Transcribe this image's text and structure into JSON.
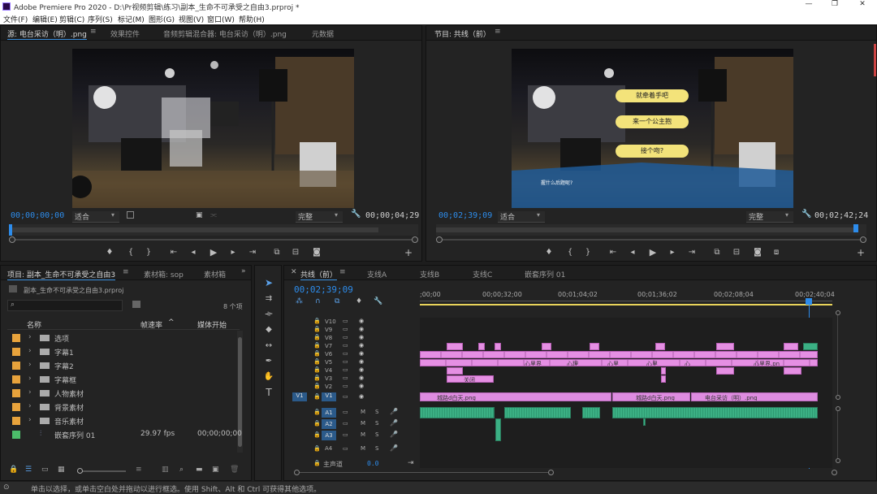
{
  "app": {
    "title": "Adobe Premiere Pro 2020 - D:\\Pr视频剪辑\\练习\\副本_生命不可承受之自由3.prproj *"
  },
  "menu": [
    "文件(F)",
    "编辑(E)",
    "剪辑(C)",
    "序列(S)",
    "标记(M)",
    "图形(G)",
    "视图(V)",
    "窗口(W)",
    "帮助(H)"
  ],
  "source": {
    "tabs": [
      "源: 电台采访（明）.png",
      "效果控件",
      "音频剪辑混合器: 电台采访（明）.png",
      "元数据"
    ],
    "timecode": "00;00;00;00",
    "fit": "适合",
    "quality": "完整",
    "duration": "00;00;04;29"
  },
  "program": {
    "tab": "节目: 共线（前）",
    "timecode": "00;02;39;09",
    "fit": "适合",
    "quality": "完整",
    "duration": "00;02;42;24",
    "bubbles": [
      "就牵着手吧",
      "来一个公主抱",
      "接个吻?"
    ],
    "caption": "握什么后题呢?"
  },
  "project": {
    "tabs": [
      "项目: 副本_生命不可承受之自由3",
      "素材箱: sop",
      "素材箱"
    ],
    "file": "副本_生命不可承受之自由3.prproj",
    "count": "8 个项",
    "col_name": "名称",
    "col_rate": "帧速率",
    "col_start": "媒体开始",
    "items": [
      {
        "name": "选项",
        "color": "#e8a33c",
        "rate": "",
        "start": ""
      },
      {
        "name": "字幕1",
        "color": "#e8a33c",
        "rate": "",
        "start": ""
      },
      {
        "name": "字幕2",
        "color": "#e8a33c",
        "rate": "",
        "start": ""
      },
      {
        "name": "字幕框",
        "color": "#e8a33c",
        "rate": "",
        "start": ""
      },
      {
        "name": "人物素材",
        "color": "#e8a33c",
        "rate": "",
        "start": ""
      },
      {
        "name": "背景素材",
        "color": "#e8a33c",
        "rate": "",
        "start": ""
      },
      {
        "name": "音乐素材",
        "color": "#e8a33c",
        "rate": "",
        "start": ""
      },
      {
        "name": "嵌套序列 01",
        "color": "#4cbc6a",
        "rate": "29.97 fps",
        "start": "00;00;00;00"
      }
    ]
  },
  "timeline": {
    "tabs": [
      "共线（前）",
      "支线A",
      "支线B",
      "支线C",
      "嵌套序列 01"
    ],
    "timecode": "00;02;39;09",
    "ruler": [
      ";00;00",
      "00;00;32;00",
      "00;01;04;02",
      "00;01;36;02",
      "00;02;08;04",
      "00;02;40;04"
    ],
    "video_tracks": [
      "V10",
      "V9",
      "V8",
      "V7",
      "V6",
      "V5",
      "V4",
      "V3",
      "V2",
      "V1"
    ],
    "audio_tracks": [
      "A1",
      "A2",
      "A3",
      "A4"
    ],
    "master": "主声道",
    "master_val": "0.0",
    "clip_labels": {
      "v5a": "心里界",
      "v5b": "心理",
      "v5c": "心里",
      "v5d": "心里",
      "v5e": "心",
      "v5f": "心里界.pn",
      "v3": "关闭",
      "v1a": "城路d白天.png",
      "v1b": "城路d白天.png",
      "v1c": "电台采访（明）.png"
    },
    "src_patch": "V1",
    "track_letters": {
      "m": "M",
      "s": "S"
    }
  },
  "status": "单击以选择，或单击空白处并拖动以进行框选。使用 Shift、Alt 和 Ctrl 可获得其他选项。"
}
